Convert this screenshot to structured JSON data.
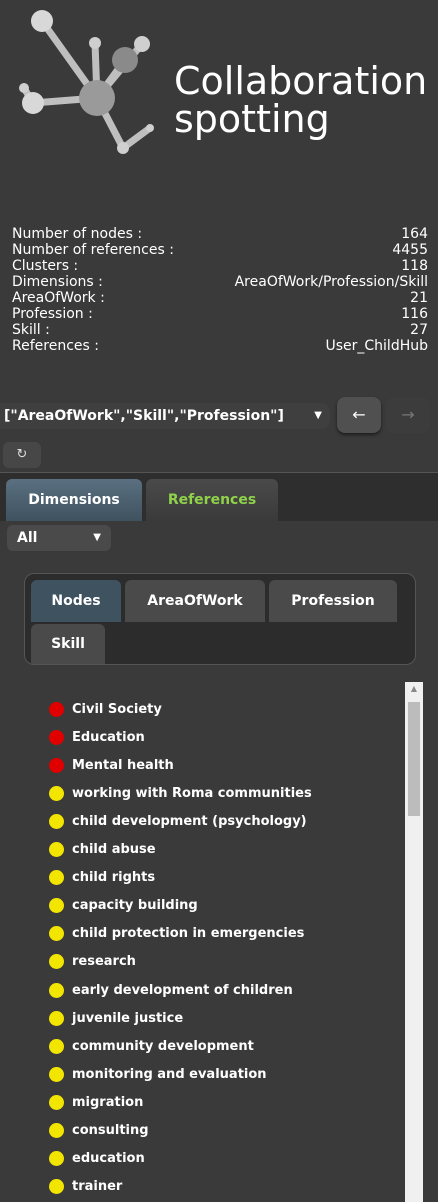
{
  "brand": {
    "title_line1": "Collaboration",
    "title_line2": "spotting"
  },
  "stats": [
    {
      "label": "Number of nodes :",
      "value": "164"
    },
    {
      "label": "Number of references :",
      "value": "4455"
    },
    {
      "label": "Clusters :",
      "value": "118"
    },
    {
      "label": "Dimensions :",
      "value": "AreaOfWork/Profession/Skill"
    },
    {
      "label": "AreaOfWork :",
      "value": "21"
    },
    {
      "label": "Profession :",
      "value": "116"
    },
    {
      "label": "Skill :",
      "value": "27"
    },
    {
      "label": "References :",
      "value": "User_ChildHub"
    }
  ],
  "toolbar": {
    "dimension_select_value": "[\"AreaOfWork\",\"Skill\",\"Profession\"]",
    "caret": "▼",
    "back_glyph": "←",
    "forward_glyph": "→",
    "refresh_glyph": "↻"
  },
  "main_tabs": [
    {
      "label": "Dimensions",
      "active": true
    },
    {
      "label": "References",
      "active": false
    }
  ],
  "filter": {
    "value": "All",
    "caret": "▼"
  },
  "sub_tabs": [
    {
      "label": "Nodes",
      "active": true
    },
    {
      "label": "AreaOfWork",
      "active": false
    },
    {
      "label": "Profession",
      "active": false
    },
    {
      "label": "Skill",
      "active": false
    }
  ],
  "colors": {
    "red": "#e00000",
    "yellow": "#f2e600",
    "accent_green": "#8fd24a"
  },
  "items": [
    {
      "label": "Civil Society",
      "color": "red"
    },
    {
      "label": "Education",
      "color": "red"
    },
    {
      "label": "Mental health",
      "color": "red"
    },
    {
      "label": "working with Roma communities",
      "color": "yellow"
    },
    {
      "label": "child development (psychology)",
      "color": "yellow"
    },
    {
      "label": "child abuse",
      "color": "yellow"
    },
    {
      "label": "child rights",
      "color": "yellow"
    },
    {
      "label": "capacity building",
      "color": "yellow"
    },
    {
      "label": "child protection in emergencies",
      "color": "yellow"
    },
    {
      "label": "research",
      "color": "yellow"
    },
    {
      "label": "early development of children",
      "color": "yellow"
    },
    {
      "label": "juvenile justice",
      "color": "yellow"
    },
    {
      "label": "community development",
      "color": "yellow"
    },
    {
      "label": "monitoring and evaluation",
      "color": "yellow"
    },
    {
      "label": "migration",
      "color": "yellow"
    },
    {
      "label": "consulting",
      "color": "yellow"
    },
    {
      "label": "education",
      "color": "yellow"
    },
    {
      "label": "trainer",
      "color": "yellow"
    }
  ]
}
